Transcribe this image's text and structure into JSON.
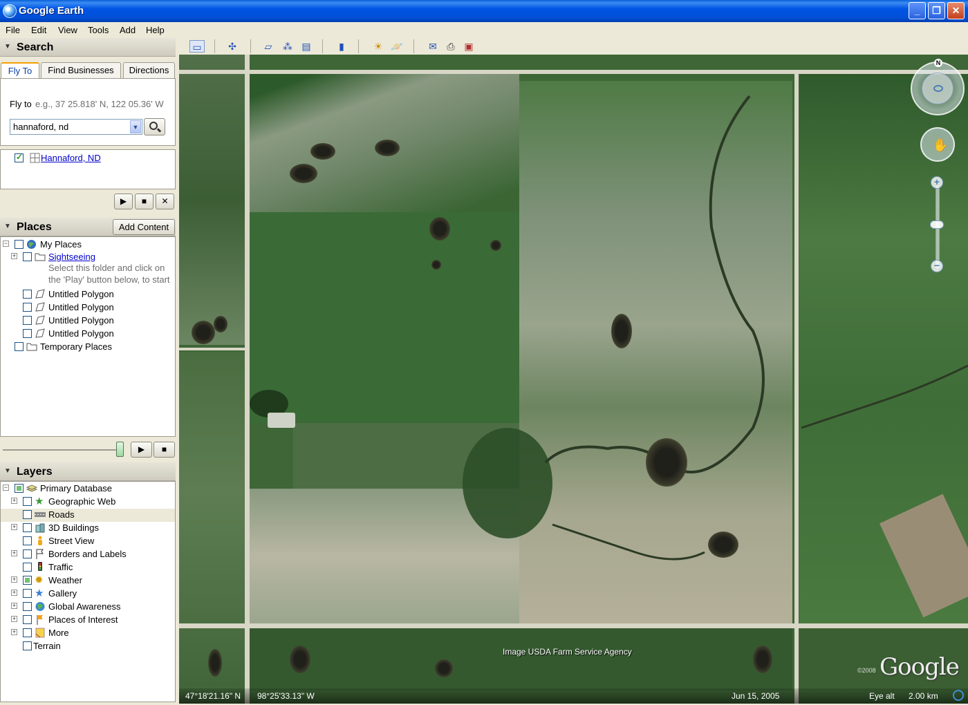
{
  "window": {
    "title": "Google Earth",
    "min": "_",
    "max": "❐",
    "close": "✕"
  },
  "menu": [
    "File",
    "Edit",
    "View",
    "Tools",
    "Add",
    "Help"
  ],
  "search": {
    "header": "Search",
    "tabs": [
      "Fly To",
      "Find Businesses",
      "Directions"
    ],
    "fly_label": "Fly to",
    "fly_hint": "e.g., 37 25.818' N, 122 05.36' W",
    "query": "hannaford, nd",
    "result": "Hannaford, ND"
  },
  "places": {
    "header": "Places",
    "add_content": "Add Content",
    "my_places": "My Places",
    "sightseeing": "Sightseeing",
    "hint_line1": "Select this folder and click on",
    "hint_line2": "the 'Play' button below, to start",
    "polygons": [
      "Untitled Polygon",
      "Untitled Polygon",
      "Untitled Polygon",
      "Untitled Polygon"
    ],
    "temporary": "Temporary Places"
  },
  "layers": {
    "header": "Layers",
    "items": [
      {
        "label": "Primary Database",
        "icon": "database-icon",
        "checked": "partial"
      },
      {
        "label": "Geographic Web",
        "icon": "star-icon",
        "checked": "none"
      },
      {
        "label": "Roads",
        "icon": "road-icon",
        "checked": "none"
      },
      {
        "label": "3D Buildings",
        "icon": "buildings-icon",
        "checked": "none"
      },
      {
        "label": "Street View",
        "icon": "pegman-icon",
        "checked": "none"
      },
      {
        "label": "Borders and Labels",
        "icon": "flag-icon",
        "checked": "none"
      },
      {
        "label": "Traffic",
        "icon": "traffic-light-icon",
        "checked": "none"
      },
      {
        "label": "Weather",
        "icon": "sun-icon",
        "checked": "partial"
      },
      {
        "label": "Gallery",
        "icon": "gallery-star-icon",
        "checked": "none"
      },
      {
        "label": "Global Awareness",
        "icon": "globe-icon",
        "checked": "none"
      },
      {
        "label": "Places of Interest",
        "icon": "poi-flag-icon",
        "checked": "none"
      },
      {
        "label": "More",
        "icon": "note-icon",
        "checked": "none"
      },
      {
        "label": "Terrain",
        "icon": "",
        "checked": "none"
      }
    ]
  },
  "map": {
    "attribution": "Image USDA Farm Service Agency",
    "logo": "Google",
    "copyright": "©2008",
    "lat": "47°18'21.16\" N",
    "lon": "98°25'33.13\" W",
    "date": "Jun 15, 2005",
    "eye_alt_label": "Eye alt",
    "eye_alt": "2.00 km",
    "north": "N"
  },
  "colors": {
    "titlebar": "#0054e3",
    "panel": "#ece9d8",
    "link": "#0000cc",
    "field": "#3e6636"
  }
}
